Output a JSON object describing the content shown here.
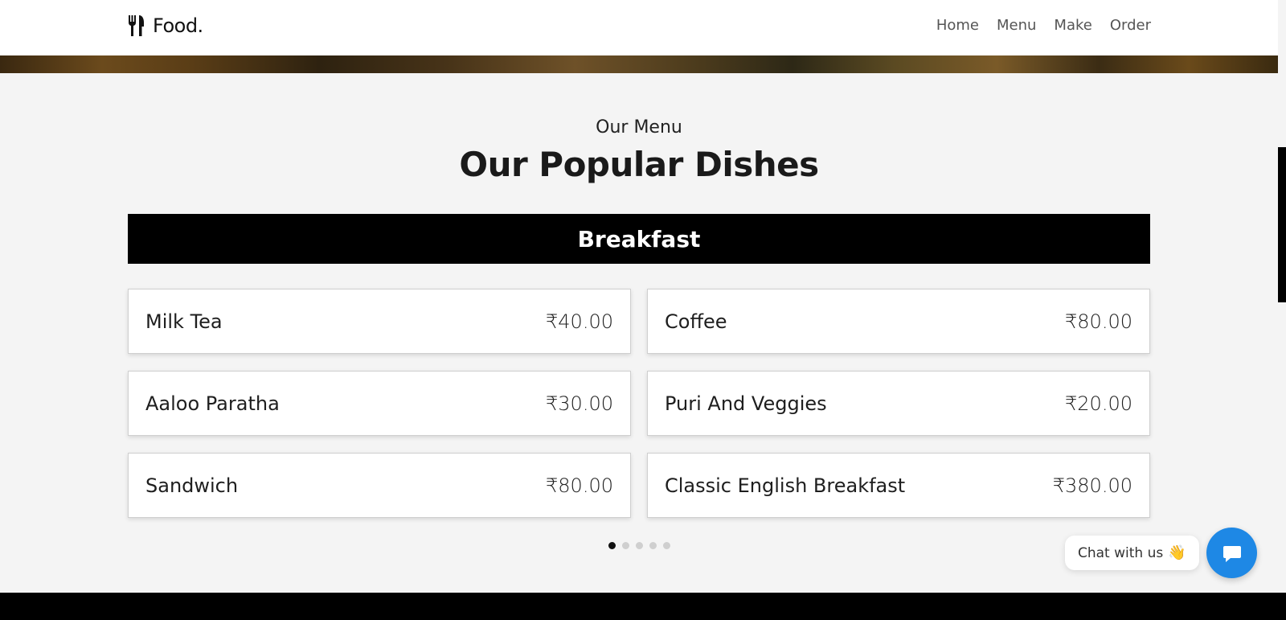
{
  "navbar": {
    "brand": "Food.",
    "brand_icon": "utensils-icon",
    "links": [
      "Home",
      "Menu",
      "Make",
      "Order"
    ]
  },
  "section": {
    "subtitle": "Our Menu",
    "title": "Our Popular Dishes"
  },
  "category": {
    "label": "Breakfast"
  },
  "menu": {
    "items": [
      {
        "name": "Milk Tea",
        "price": "₹40.00"
      },
      {
        "name": "Coffee",
        "price": "₹80.00"
      },
      {
        "name": "Aaloo Paratha",
        "price": "₹30.00"
      },
      {
        "name": "Puri And Veggies",
        "price": "₹20.00"
      },
      {
        "name": "Sandwich",
        "price": "₹80.00"
      },
      {
        "name": "Classic English Breakfast",
        "price": "₹380.00"
      }
    ]
  },
  "pagination": {
    "total": 5,
    "active_index": 0
  },
  "chat": {
    "label": "Chat with us",
    "wave_icon": "waving-hand-icon",
    "button_icon": "chat-icon",
    "button_color": "#1e88e5"
  }
}
